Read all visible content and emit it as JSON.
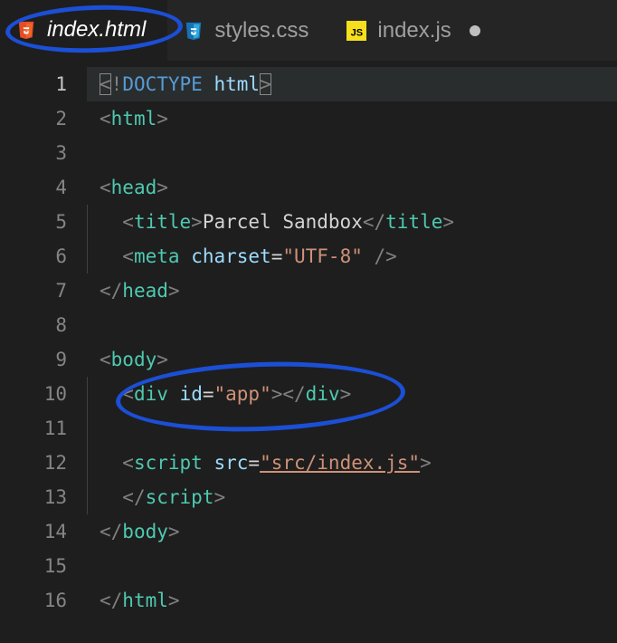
{
  "tabs": [
    {
      "label": "index.html",
      "icon": "html5-icon",
      "active": true,
      "dirty": false
    },
    {
      "label": "styles.css",
      "icon": "css3-icon",
      "active": false,
      "dirty": false
    },
    {
      "label": "index.js",
      "icon": "js-icon",
      "active": false,
      "dirty": true
    }
  ],
  "editor": {
    "current_line": 1,
    "lines": [
      1,
      2,
      3,
      4,
      5,
      6,
      7,
      8,
      9,
      10,
      11,
      12,
      13,
      14,
      15,
      16
    ],
    "code": {
      "l1": {
        "open": "<",
        "bang": "!",
        "kw": "DOCTYPE",
        "sp": " ",
        "val": "html",
        "close": ">"
      },
      "l2": {
        "open": "<",
        "tag": "html",
        "close": ">"
      },
      "l4": {
        "open": "<",
        "tag": "head",
        "close": ">"
      },
      "l5": {
        "indent": "  ",
        "open": "<",
        "tag": "title",
        "close": ">",
        "text": "Parcel Sandbox",
        "oclose": "</",
        "ctag": "title",
        "cclose": ">"
      },
      "l6": {
        "indent": "  ",
        "open": "<",
        "tag": "meta",
        "sp": " ",
        "attr": "charset",
        "eq": "=",
        "str": "\"UTF-8\"",
        "selfclose": " />"
      },
      "l7": {
        "oclose": "</",
        "tag": "head",
        "close": ">"
      },
      "l9": {
        "open": "<",
        "tag": "body",
        "close": ">"
      },
      "l10": {
        "indent": "  ",
        "open": "<",
        "tag": "div",
        "sp": " ",
        "attr": "id",
        "eq": "=",
        "str": "\"app\"",
        "close": ">",
        "oclose": "</",
        "ctag": "div",
        "cclose": ">"
      },
      "l12": {
        "indent": "  ",
        "open": "<",
        "tag": "script",
        "sp": " ",
        "attr": "src",
        "eq": "=",
        "str": "\"src/index.js\"",
        "close": ">"
      },
      "l13": {
        "indent": "  ",
        "oclose": "</",
        "tag": "script",
        "close": ">"
      },
      "l14": {
        "oclose": "</",
        "tag": "body",
        "close": ">"
      },
      "l16": {
        "oclose": "</",
        "tag": "html",
        "close": ">"
      }
    }
  }
}
